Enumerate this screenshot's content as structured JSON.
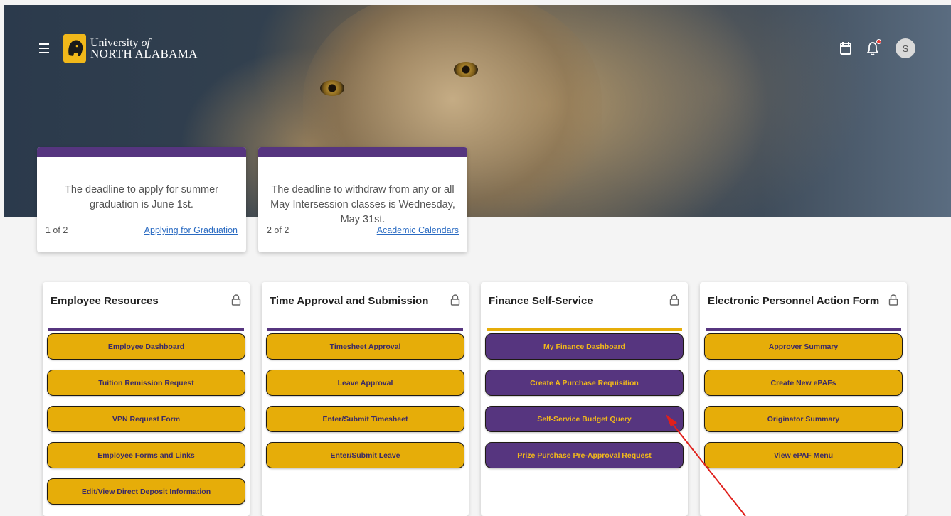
{
  "header": {
    "logo_line1": "University",
    "logo_line1_suffix": "of",
    "logo_line2": "NORTH ALABAMA",
    "icons": [
      "menu-icon",
      "calendar-icon",
      "bell-icon",
      "avatar"
    ],
    "avatar_initial": "S"
  },
  "announcements": [
    {
      "message": "The deadline to apply for summer graduation is June 1st.",
      "counter": "1 of 2",
      "link": "Applying for Graduation"
    },
    {
      "message": "The deadline to withdraw from any or all May Intersession classes is Wednesday, May 31st.",
      "counter": "2 of 2",
      "link": "Academic Calendars"
    }
  ],
  "cards": [
    {
      "title": "Employee Resources",
      "buttons": [
        "Employee Dashboard",
        "Tuition Remission Request",
        "VPN Request Form",
        "Employee Forms and Links",
        "Edit/View Direct Deposit Information"
      ]
    },
    {
      "title": "Time Approval and Submission",
      "buttons": [
        "Timesheet Approval",
        "Leave Approval",
        "Enter/Submit Timesheet",
        "Enter/Submit Leave"
      ]
    },
    {
      "title": "Finance Self-Service",
      "buttons": [
        "My Finance Dashboard",
        "Create A Purchase Requisition",
        "Self-Service Budget Query",
        "Prize Purchase Pre-Approval Request"
      ]
    },
    {
      "title": "Electronic Personnel Action Form",
      "buttons": [
        "Approver Summary",
        "Create New ePAFs",
        "Originator Summary",
        "View ePAF Menu"
      ]
    }
  ],
  "colors": {
    "purple": "#56357f",
    "gold": "#e6ad09",
    "annotation_arrow": "#e0201c"
  }
}
